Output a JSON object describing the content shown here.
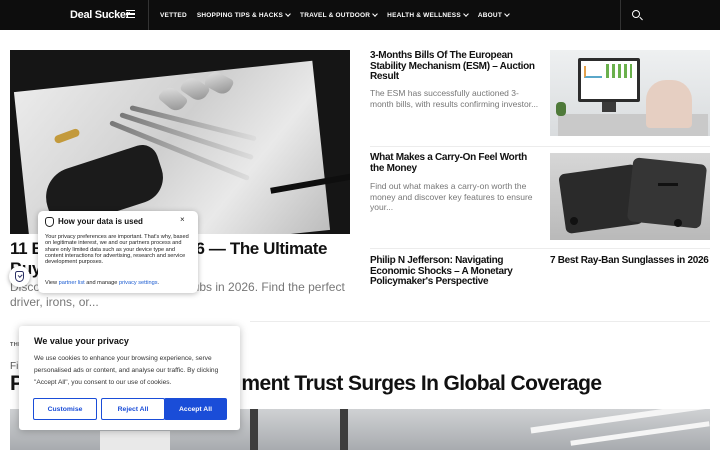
{
  "header": {
    "logo": "Deal Sucker",
    "nav": [
      {
        "label": "VETTED",
        "has_dropdown": false
      },
      {
        "label": "SHOPPING TIPS & HACKS",
        "has_dropdown": true
      },
      {
        "label": "TRAVEL & OUTDOOR",
        "has_dropdown": true
      },
      {
        "label": "HEALTH & WELLNESS",
        "has_dropdown": true
      },
      {
        "label": "ABOUT",
        "has_dropdown": true
      }
    ],
    "icons": {
      "menu": "hamburger-icon",
      "search": "search-icon",
      "dropdown": "chevron-down-icon"
    }
  },
  "hero": {
    "title_visible_start": "11 B",
    "title_visible_end": "2026 — The Ultimate",
    "title_line2_fragment": "Buy",
    "excerpt_fragment_start": "Disco",
    "excerpt_fragment_end": "lubs in 2026. Find the perfect",
    "excerpt_line2": "driver, irons, or..."
  },
  "articles": [
    {
      "title": "3-Months Bills Of The European Stability Mechanism (ESM) – Auction Result",
      "excerpt": "The ESM has successfully auctioned 3-month bills, with results confirming investor..."
    },
    {
      "title": "What Makes a Carry-On Feel Worth the Money",
      "excerpt": "Find out what makes a carry-on worth the money and discover key features to ensure your..."
    },
    {
      "title": "Philip N Jefferson: Navigating Economic Shocks – A Monetary Policymaker's Perspective",
      "excerpt": ""
    },
    {
      "title": "7 Best Ray-Ban Sunglasses in 2026",
      "excerpt": ""
    }
  ],
  "lower": {
    "category_fragment": "THE",
    "title_line1_fragment": "Fi",
    "title_start_fragment": "P",
    "title_end_fragment": "ment Trust Surges In Global Coverage"
  },
  "privacy_popup": {
    "title": "How your data is used",
    "close": "×",
    "body": "Your privacy preferences are important. That's why, based on legitimate interest, we and our partners process and share only limited data such as your device type and content interactions for advertising, research and service development purposes.",
    "links_prefix": "View",
    "partner_link": "partner list",
    "links_middle": "and manage",
    "privacy_link": "privacy settings",
    "links_suffix": ".",
    "icon": "shield-icon"
  },
  "privacy_badge": {
    "icon": "shield-check-icon"
  },
  "cookie_banner": {
    "title": "We value your privacy",
    "text": "We use cookies to enhance your browsing experience, serve personalised ads or content, and analyse our traffic. By clicking \"Accept All\", you consent to our use of cookies.",
    "buttons": {
      "customise": "Customise",
      "reject": "Reject All",
      "accept": "Accept All"
    }
  },
  "colors": {
    "header_bg": "#0d0d0d",
    "accent_blue": "#1a4dd8",
    "link_blue": "#1a5bd1",
    "excerpt_gray": "#777777"
  }
}
